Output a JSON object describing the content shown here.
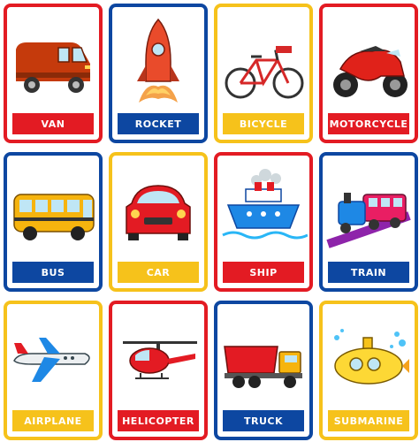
{
  "colors": {
    "red": "#e31b23",
    "blue": "#0d47a1",
    "yellow": "#f6c21b"
  },
  "cards": [
    {
      "label": "VAN",
      "color": "red",
      "icon": "van-icon"
    },
    {
      "label": "ROCKET",
      "color": "blue",
      "icon": "rocket-icon"
    },
    {
      "label": "BICYCLE",
      "color": "yellow",
      "icon": "bicycle-icon"
    },
    {
      "label": "MOTORCYCLE",
      "color": "red",
      "icon": "motorcycle-icon"
    },
    {
      "label": "BUS",
      "color": "blue",
      "icon": "bus-icon"
    },
    {
      "label": "CAR",
      "color": "yellow",
      "icon": "car-icon"
    },
    {
      "label": "SHIP",
      "color": "red",
      "icon": "ship-icon"
    },
    {
      "label": "TRAIN",
      "color": "blue",
      "icon": "train-icon"
    },
    {
      "label": "AIRPLANE",
      "color": "yellow",
      "icon": "airplane-icon"
    },
    {
      "label": "HELICOPTER",
      "color": "red",
      "icon": "helicopter-icon"
    },
    {
      "label": "TRUCK",
      "color": "blue",
      "icon": "truck-icon"
    },
    {
      "label": "SUBMARINE",
      "color": "yellow",
      "icon": "submarine-icon"
    }
  ]
}
